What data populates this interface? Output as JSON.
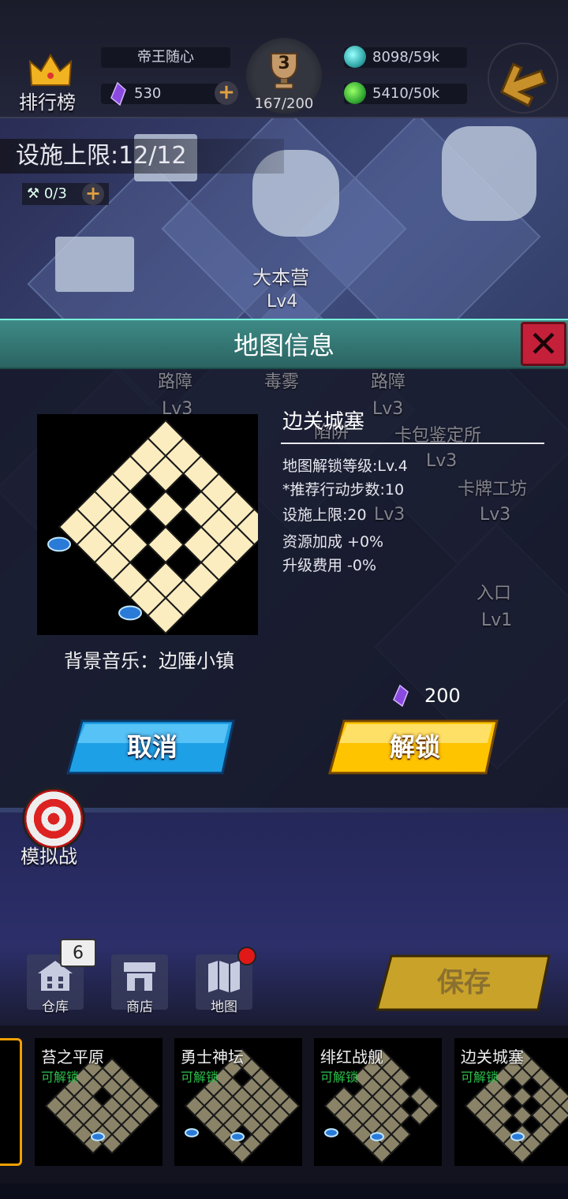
{
  "header": {
    "rank_label": "排行榜",
    "player_name": "帝王随心",
    "gems": "530",
    "trophy_level": "3",
    "trophy_progress": "167/200",
    "resource_1": "8098/59k",
    "resource_2": "5410/50k"
  },
  "map": {
    "facility_limit": "设施上限:12/12",
    "tools": "0/3",
    "hq_label": "大本营",
    "hq_level": "Lv4",
    "faded_labels": [
      "路障",
      "毒雾",
      "路障",
      "Lv3",
      "Lv3",
      "卡包鉴定所",
      "陷阱",
      "Lv3",
      "卡牌工坊",
      "Lv3",
      "Lv3",
      "入口",
      "Lv1"
    ]
  },
  "dialog": {
    "title": "地图信息",
    "map_name": "边关城塞",
    "unlock_level": "地图解锁等级:Lv.4",
    "recommended_steps": "*推荐行动步数:10",
    "facility_cap": "设施上限:20",
    "resource_bonus": "资源加成 +0%",
    "upgrade_cost": "升级费用 -0%",
    "bgm": "背景音乐：边陲小镇",
    "unlock_cost": "200",
    "cancel_label": "取消",
    "unlock_label": "解锁"
  },
  "lower": {
    "sim_label": "模拟战",
    "storage_label": "仓库",
    "storage_count": "6",
    "shop_label": "商店",
    "map_label": "地图",
    "save_label": "保存"
  },
  "map_cards": [
    {
      "name": "苔之平原",
      "status": "可解锁"
    },
    {
      "name": "勇士神坛",
      "status": "可解锁"
    },
    {
      "name": "绯红战舰",
      "status": "可解锁"
    },
    {
      "name": "边关城塞",
      "status": "可解锁"
    }
  ],
  "colors": {
    "dialog_header": "#3e8a86",
    "cancel_button": "#1ea0e6",
    "unlock_button": "#ffc400",
    "status_unlockable": "#2cc24a",
    "close_button": "#c4203a"
  }
}
